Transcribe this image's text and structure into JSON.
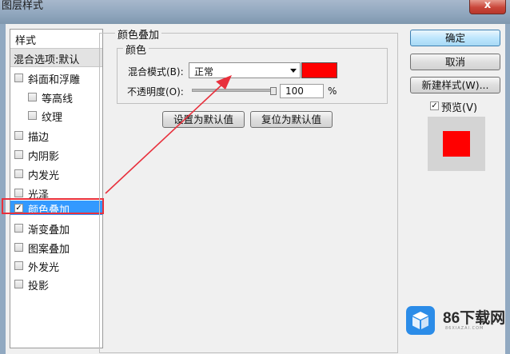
{
  "window": {
    "title": "图层样式",
    "close_label": "x"
  },
  "style_list": {
    "header": "样式",
    "blend_options": "混合选项:默认",
    "items": [
      {
        "label": "斜面和浮雕",
        "checked": false
      },
      {
        "label": "等高线",
        "checked": false
      },
      {
        "label": "纹理",
        "checked": false
      },
      {
        "label": "描边",
        "checked": false
      },
      {
        "label": "内阴影",
        "checked": false
      },
      {
        "label": "内发光",
        "checked": false
      },
      {
        "label": "光泽",
        "checked": false
      },
      {
        "label": "颜色叠加",
        "checked": true,
        "selected": true,
        "check_mark": "✓"
      },
      {
        "label": "渐变叠加",
        "checked": false
      },
      {
        "label": "图案叠加",
        "checked": false
      },
      {
        "label": "外发光",
        "checked": false
      },
      {
        "label": "投影",
        "checked": false
      }
    ]
  },
  "color_overlay": {
    "title": "颜色叠加",
    "group_title": "颜色",
    "blend_mode_label": "混合模式(B):",
    "blend_mode_value": "正常",
    "overlay_color": "#ff0000",
    "opacity_label": "不透明度(O):",
    "opacity_value": "100",
    "opacity_unit": "%",
    "set_default_label": "设置为默认值",
    "reset_default_label": "复位为默认值"
  },
  "actions": {
    "ok_label": "确定",
    "cancel_label": "取消",
    "new_style_label": "新建样式(W)...",
    "preview_label": "预览(V)",
    "preview_check_mark": "✓"
  },
  "watermark": {
    "brand": "86下载网",
    "domain": "86XIAZAI.COM"
  },
  "colors": {
    "accent_red": "#ff0000",
    "selection_blue": "#3399ff",
    "annotation_red": "#e8303c"
  }
}
